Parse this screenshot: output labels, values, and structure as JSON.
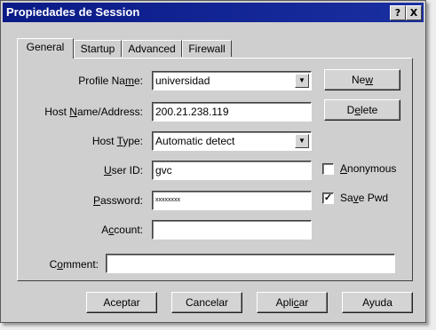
{
  "window": {
    "title": "Propiedades de Session",
    "help_btn": "?",
    "close_btn": "X"
  },
  "tabs": [
    {
      "label": "General",
      "active": true
    },
    {
      "label": "Startup",
      "active": false
    },
    {
      "label": "Advanced",
      "active": false
    },
    {
      "label": "Firewall",
      "active": false
    }
  ],
  "form": {
    "profile_name": {
      "label_pre": "Profile Na",
      "label_u": "m",
      "label_post": "e:",
      "value": "universidad"
    },
    "host_name": {
      "label_pre": "Host ",
      "label_u": "N",
      "label_post": "ame/Address:",
      "value": "200.21.238.119"
    },
    "host_type": {
      "label_pre": "Host ",
      "label_u": "T",
      "label_post": "ype:",
      "value": "Automatic detect"
    },
    "user_id": {
      "label_pre": "",
      "label_u": "U",
      "label_post": "ser ID:",
      "value": "gvc"
    },
    "password": {
      "label_pre": "",
      "label_u": "P",
      "label_post": "assword:",
      "value": "xxxxxxxx"
    },
    "account": {
      "label_pre": "A",
      "label_u": "c",
      "label_post": "count:",
      "value": ""
    },
    "comment": {
      "label_pre": "C",
      "label_u": "o",
      "label_post": "mment:",
      "value": ""
    }
  },
  "side": {
    "new_pre": "Ne",
    "new_u": "w",
    "new_post": "",
    "delete_pre": "D",
    "delete_u": "e",
    "delete_post": "lete",
    "anonymous": {
      "pre": "",
      "u": "A",
      "post": "nonymous",
      "checked": false,
      "mark": ""
    },
    "save_pwd": {
      "pre": "Sa",
      "u": "v",
      "post": "e Pwd",
      "checked": true,
      "mark": "✓"
    }
  },
  "buttons": {
    "aceptar": "Aceptar",
    "cancelar": "Cancelar",
    "aplicar_pre": "Apli",
    "aplicar_u": "c",
    "aplicar_post": "ar",
    "ayuda": "Ayuda"
  },
  "icons": {
    "dropdown": "▼"
  }
}
